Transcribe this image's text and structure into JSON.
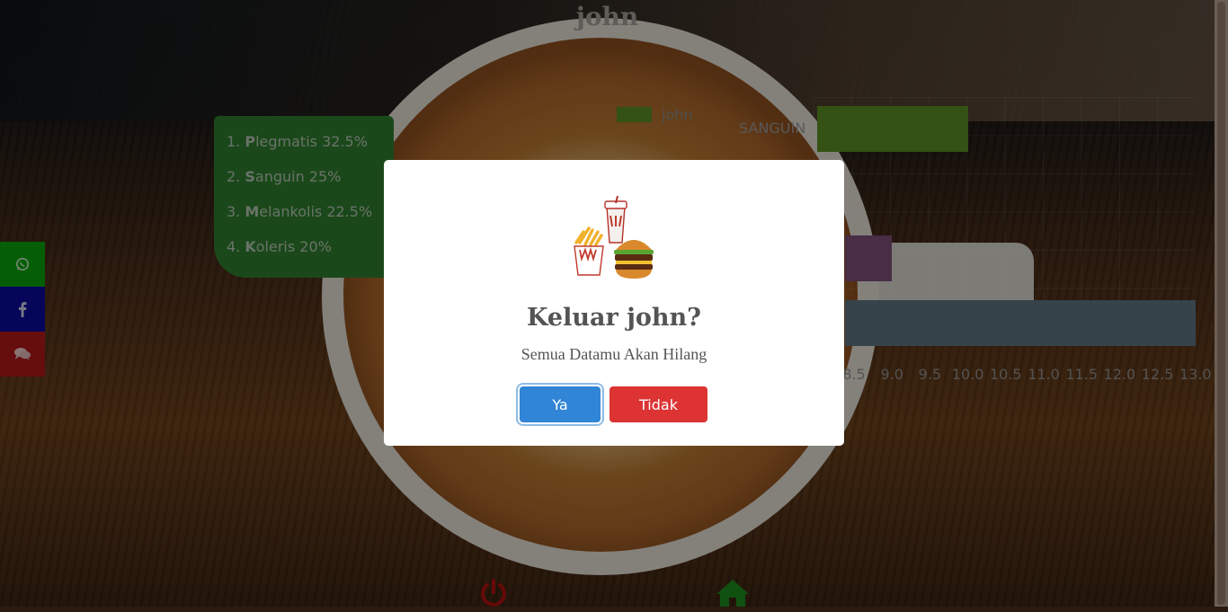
{
  "page": {
    "title": "john"
  },
  "ranking": {
    "items": [
      {
        "number": "1.",
        "initial": "P",
        "rest": "legmatis 32.5%"
      },
      {
        "number": "2.",
        "initial": "S",
        "rest": "anguin 25%"
      },
      {
        "number": "3.",
        "initial": "M",
        "rest": "elankolis 22.5%"
      },
      {
        "number": "4.",
        "initial": "K",
        "rest": "oleris 20%"
      }
    ],
    "color": "#2f7d2d"
  },
  "chart_data": {
    "type": "bar",
    "orientation": "horizontal",
    "legend": {
      "label": "john",
      "color": "#5a8d22",
      "placement": "top"
    },
    "visible_category_labels": [
      "SANGUIN"
    ],
    "visible_ticks": [
      "8.5",
      "9.0",
      "9.5",
      "10.0",
      "10.5",
      "11.0",
      "11.5",
      "12.0",
      "12.5",
      "13.0"
    ],
    "bars": [
      {
        "label": "SANGUIN",
        "end": 10.0,
        "color": "#5a8d22"
      },
      {
        "label": "",
        "end": 9.0,
        "color": "#7d4f78"
      },
      {
        "label": "",
        "end": 13.0,
        "color": "#5d7480"
      }
    ],
    "xlim": [
      8.5,
      13.0
    ],
    "grid": true
  },
  "social": [
    {
      "name": "whatsapp",
      "color": "#0aa30a"
    },
    {
      "name": "facebook",
      "color": "#0a0a9c"
    },
    {
      "name": "chat",
      "color": "#b01818"
    }
  ],
  "modal": {
    "title": "Keluar john?",
    "text": "Semua Datamu Akan Hilang",
    "confirm_label": "Ya",
    "cancel_label": "Tidak",
    "confirm_color": "#3085d6",
    "cancel_color": "#dd3333"
  },
  "bottom_nav": {
    "power_color": "#b01010",
    "home_color": "#1d8a1d"
  }
}
